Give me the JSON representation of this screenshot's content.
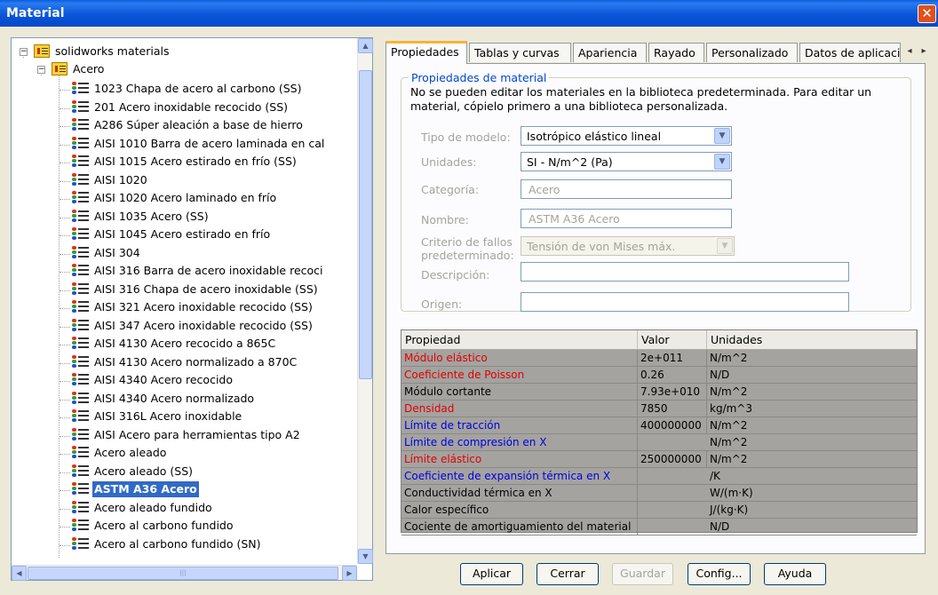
{
  "window": {
    "title": "Material",
    "close_glyph": "✕"
  },
  "tree": {
    "root": {
      "label": "solidworks materials",
      "toggle": "−"
    },
    "group": {
      "label": "Acero",
      "toggle": "−"
    },
    "items": [
      "1023 Chapa de acero al carbono (SS)",
      "201 Acero inoxidable recocido (SS)",
      "A286 Súper aleación a base de hierro",
      "AISI 1010 Barra de acero laminada en cal",
      "AISI 1015 Acero estirado en frío (SS)",
      "AISI 1020",
      "AISI 1020 Acero laminado en frío",
      "AISI 1035 Acero (SS)",
      "AISI 1045 Acero estirado en frío",
      "AISI 304",
      "AISI 316 Barra de acero inoxidable recoci",
      "AISI 316 Chapa de acero inoxidable (SS)",
      "AISI 321 Acero inoxidable recocido (SS)",
      "AISI 347 Acero inoxidable recocido (SS)",
      "AISI 4130 Acero recocido a 865C",
      "AISI 4130 Acero normalizado a 870C",
      "AISI 4340 Acero recocido",
      "AISI 4340 Acero normalizado",
      "AISI 316L Acero inoxidable",
      "AISI Acero para herramientas tipo A2",
      "Acero aleado",
      "Acero aleado (SS)",
      "ASTM A36 Acero",
      "Acero aleado fundido",
      "Acero al carbono fundido",
      "Acero al carbono fundido (SN)"
    ],
    "selected_index": 22,
    "scroll_up": "▲",
    "scroll_down": "▼",
    "scroll_left": "◀",
    "scroll_right": "▶",
    "hthumb_grip": "|||"
  },
  "tabs": {
    "labels": [
      "Propiedades",
      "Tablas y curvas",
      "Apariencia",
      "Rayado",
      "Personalizado",
      "Datos de aplicación"
    ],
    "active": 0,
    "scroll_left": "◂",
    "scroll_right": "▸"
  },
  "properties": {
    "group_title": "Propiedades de material",
    "notice": "No se pueden editar los materiales en la biblioteca predeterminada. Para editar un material, cópielo primero a una biblioteca personalizada.",
    "model_type_label": "Tipo de modelo:",
    "model_type_value": "Isotrópico elástico lineal",
    "units_label": "Unidades:",
    "units_value": "SI - N/m^2 (Pa)",
    "category_label": "Categoría:",
    "category_value": "Acero",
    "name_label": "Nombre:",
    "name_value": "ASTM A36 Acero",
    "failure_label_1": "Criterio de fallos",
    "failure_label_2": "predeterminado:",
    "failure_value": "Tensión de von Mises máx.",
    "description_label": "Descripción:",
    "description_value": "",
    "origin_label": "Origen:",
    "origin_value": "",
    "dropdown_glyph": "▼"
  },
  "table": {
    "headers": [
      "Propiedad",
      "Valor",
      "Unidades"
    ],
    "rows": [
      {
        "property": "Módulo elástico",
        "value": "2e+011",
        "units": "N/m^2",
        "color": "#e00000"
      },
      {
        "property": "Coeficiente de Poisson",
        "value": "0.26",
        "units": "N/D",
        "color": "#e00000"
      },
      {
        "property": "Módulo cortante",
        "value": "7.93e+010",
        "units": "N/m^2",
        "color": "#000000"
      },
      {
        "property": "Densidad",
        "value": "7850",
        "units": "kg/m^3",
        "color": "#e00000"
      },
      {
        "property": "Límite de tracción",
        "value": "400000000",
        "units": "N/m^2",
        "color": "#0000e0"
      },
      {
        "property": "Límite de compresión en X",
        "value": "",
        "units": "N/m^2",
        "color": "#0000e0"
      },
      {
        "property": "Límite elástico",
        "value": "250000000",
        "units": "N/m^2",
        "color": "#e00000"
      },
      {
        "property": "Coeficiente de expansión térmica en X",
        "value": "",
        "units": "/K",
        "color": "#0000e0"
      },
      {
        "property": "Conductividad térmica en X",
        "value": "",
        "units": "W/(m·K)",
        "color": "#000000"
      },
      {
        "property": "Calor específico",
        "value": "",
        "units": "J/(kg·K)",
        "color": "#000000"
      },
      {
        "property": "Cociente de amortiguamiento del material",
        "value": "",
        "units": "N/D",
        "color": "#000000"
      }
    ]
  },
  "buttons": {
    "apply": "Aplicar",
    "close": "Cerrar",
    "save": "Guardar",
    "config": "Config...",
    "help": "Ayuda"
  }
}
